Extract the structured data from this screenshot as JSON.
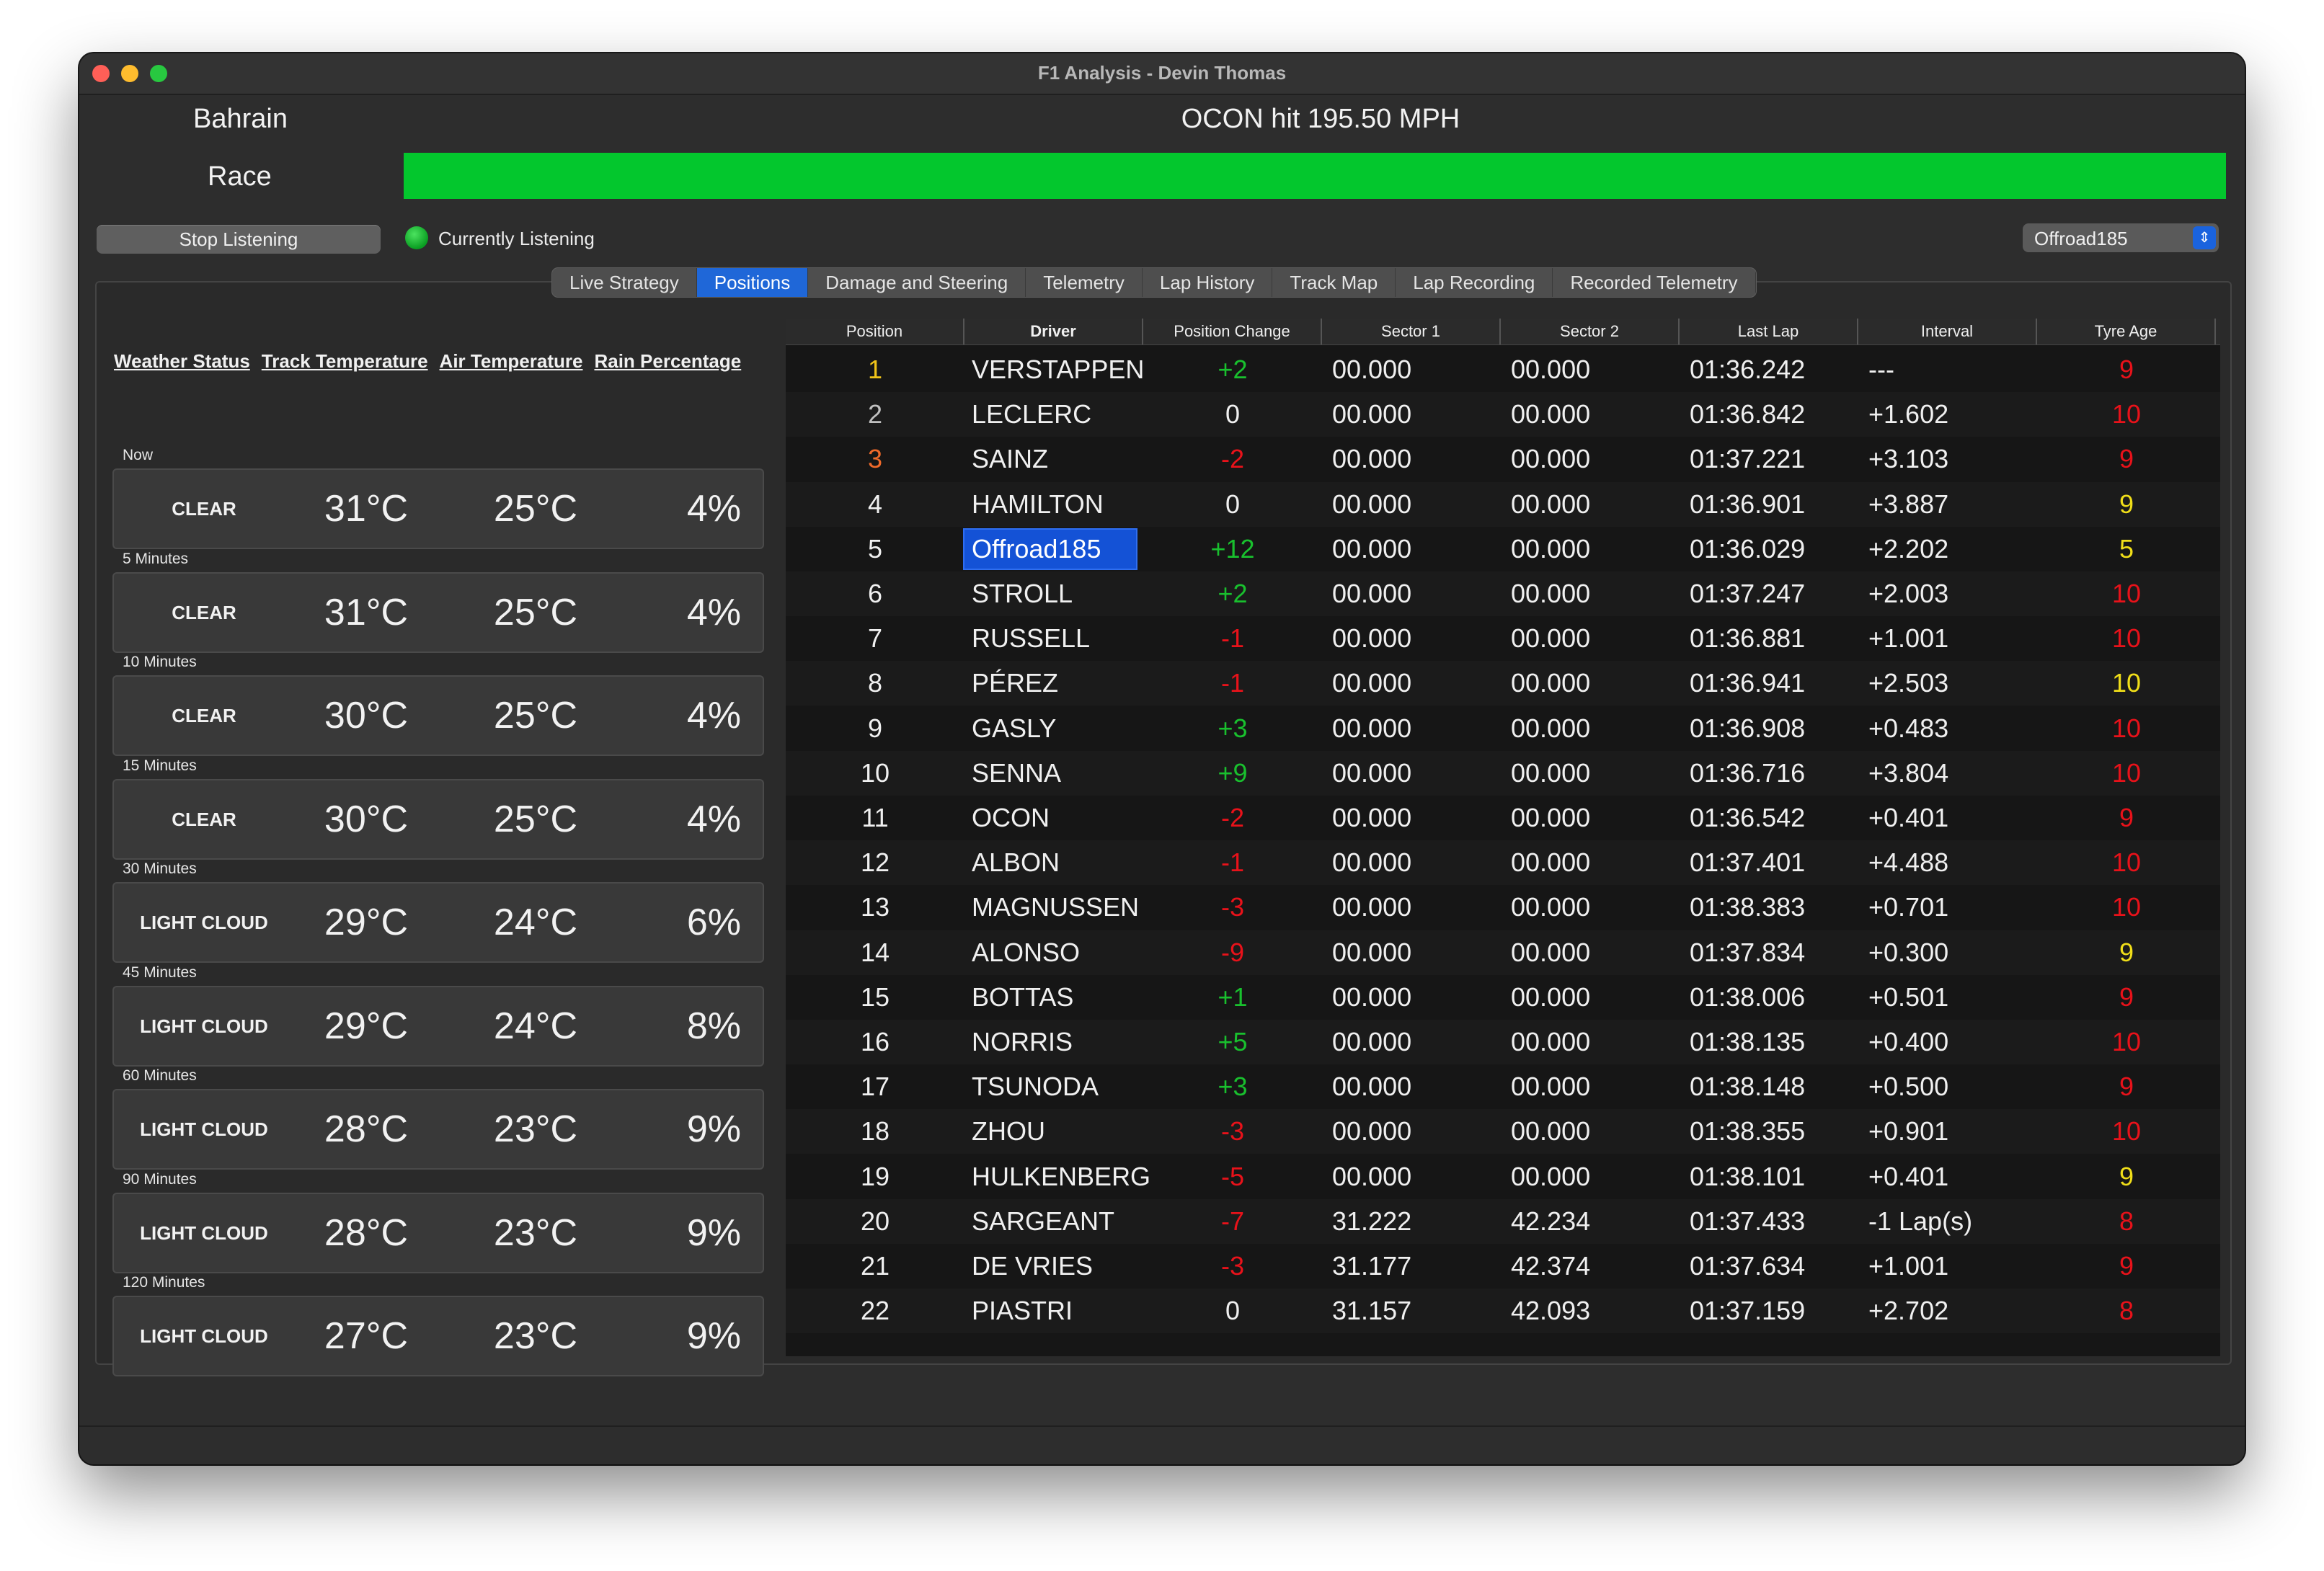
{
  "window": {
    "title": "F1 Analysis - Devin Thomas"
  },
  "header": {
    "track": "Bahrain",
    "session": "Race",
    "headline": "OCON hit 195.50 MPH",
    "progress": 1.0,
    "progress_color": "#03c72d"
  },
  "controls": {
    "stop_label": "Stop Listening",
    "status_label": "Currently Listening",
    "status_color": "#1fbf3a",
    "driver_select": "Offroad185"
  },
  "tabs": [
    {
      "label": "Live Strategy",
      "active": false
    },
    {
      "label": "Positions",
      "active": true
    },
    {
      "label": "Damage and Steering",
      "active": false
    },
    {
      "label": "Telemetry",
      "active": false
    },
    {
      "label": "Lap History",
      "active": false
    },
    {
      "label": "Track Map",
      "active": false
    },
    {
      "label": "Lap Recording",
      "active": false
    },
    {
      "label": "Recorded Telemetry",
      "active": false
    }
  ],
  "weather": {
    "headers": [
      "Weather Status",
      "Track Temperature",
      "Air Temperature",
      "Rain Percentage"
    ],
    "forecasts": [
      {
        "label": "Now",
        "condition": "CLEAR",
        "track": "31°C",
        "air": "25°C",
        "rain": "4%"
      },
      {
        "label": "5 Minutes",
        "condition": "CLEAR",
        "track": "31°C",
        "air": "25°C",
        "rain": "4%"
      },
      {
        "label": "10 Minutes",
        "condition": "CLEAR",
        "track": "30°C",
        "air": "25°C",
        "rain": "4%"
      },
      {
        "label": "15 Minutes",
        "condition": "CLEAR",
        "track": "30°C",
        "air": "25°C",
        "rain": "4%"
      },
      {
        "label": "30 Minutes",
        "condition": "LIGHT CLOUD",
        "track": "29°C",
        "air": "24°C",
        "rain": "6%"
      },
      {
        "label": "45 Minutes",
        "condition": "LIGHT CLOUD",
        "track": "29°C",
        "air": "24°C",
        "rain": "8%"
      },
      {
        "label": "60 Minutes",
        "condition": "LIGHT CLOUD",
        "track": "28°C",
        "air": "23°C",
        "rain": "9%"
      },
      {
        "label": "90 Minutes",
        "condition": "LIGHT CLOUD",
        "track": "28°C",
        "air": "23°C",
        "rain": "9%"
      },
      {
        "label": "120 Minutes",
        "condition": "LIGHT CLOUD",
        "track": "27°C",
        "air": "23°C",
        "rain": "9%"
      }
    ]
  },
  "positions": {
    "columns": [
      "Position",
      "Driver",
      "Position Change",
      "Sector 1",
      "Sector 2",
      "Last Lap",
      "Interval",
      "Tyre Age"
    ],
    "colors": {
      "gold": "#f0c419",
      "silver": "#c0c0c0",
      "bronze": "#f06a2a",
      "gain": "#19c02e",
      "loss": "#e8121a",
      "neutral": "#f0f0f0",
      "tyre_red": "#e8121a",
      "tyre_yellow": "#f0de19"
    },
    "rows": [
      {
        "pos": "1",
        "driver": "VERSTAPPEN",
        "change": "+2",
        "s1": "00.000",
        "s2": "00.000",
        "last": "01:36.242",
        "interval": "---",
        "tyre": "9",
        "pos_color": "gold",
        "change_color": "gain",
        "tyre_color": "tyre_red"
      },
      {
        "pos": "2",
        "driver": "LECLERC",
        "change": "0",
        "s1": "00.000",
        "s2": "00.000",
        "last": "01:36.842",
        "interval": "+1.602",
        "tyre": "10",
        "pos_color": "silver",
        "change_color": "neutral",
        "tyre_color": "tyre_red"
      },
      {
        "pos": "3",
        "driver": "SAINZ",
        "change": "-2",
        "s1": "00.000",
        "s2": "00.000",
        "last": "01:37.221",
        "interval": "+3.103",
        "tyre": "9",
        "pos_color": "bronze",
        "change_color": "loss",
        "tyre_color": "tyre_red"
      },
      {
        "pos": "4",
        "driver": "HAMILTON",
        "change": "0",
        "s1": "00.000",
        "s2": "00.000",
        "last": "01:36.901",
        "interval": "+3.887",
        "tyre": "9",
        "pos_color": "neutral",
        "change_color": "neutral",
        "tyre_color": "tyre_yellow"
      },
      {
        "pos": "5",
        "driver": "Offroad185",
        "change": "+12",
        "s1": "00.000",
        "s2": "00.000",
        "last": "01:36.029",
        "interval": "+2.202",
        "tyre": "5",
        "pos_color": "neutral",
        "change_color": "gain",
        "tyre_color": "tyre_yellow",
        "highlight": true
      },
      {
        "pos": "6",
        "driver": "STROLL",
        "change": "+2",
        "s1": "00.000",
        "s2": "00.000",
        "last": "01:37.247",
        "interval": "+2.003",
        "tyre": "10",
        "pos_color": "neutral",
        "change_color": "gain",
        "tyre_color": "tyre_red"
      },
      {
        "pos": "7",
        "driver": "RUSSELL",
        "change": "-1",
        "s1": "00.000",
        "s2": "00.000",
        "last": "01:36.881",
        "interval": "+1.001",
        "tyre": "10",
        "pos_color": "neutral",
        "change_color": "loss",
        "tyre_color": "tyre_red"
      },
      {
        "pos": "8",
        "driver": "PÉREZ",
        "change": "-1",
        "s1": "00.000",
        "s2": "00.000",
        "last": "01:36.941",
        "interval": "+2.503",
        "tyre": "10",
        "pos_color": "neutral",
        "change_color": "loss",
        "tyre_color": "tyre_yellow"
      },
      {
        "pos": "9",
        "driver": "GASLY",
        "change": "+3",
        "s1": "00.000",
        "s2": "00.000",
        "last": "01:36.908",
        "interval": "+0.483",
        "tyre": "10",
        "pos_color": "neutral",
        "change_color": "gain",
        "tyre_color": "tyre_red"
      },
      {
        "pos": "10",
        "driver": "SENNA",
        "change": "+9",
        "s1": "00.000",
        "s2": "00.000",
        "last": "01:36.716",
        "interval": "+3.804",
        "tyre": "10",
        "pos_color": "neutral",
        "change_color": "gain",
        "tyre_color": "tyre_red"
      },
      {
        "pos": "11",
        "driver": "OCON",
        "change": "-2",
        "s1": "00.000",
        "s2": "00.000",
        "last": "01:36.542",
        "interval": "+0.401",
        "tyre": "9",
        "pos_color": "neutral",
        "change_color": "loss",
        "tyre_color": "tyre_red"
      },
      {
        "pos": "12",
        "driver": "ALBON",
        "change": "-1",
        "s1": "00.000",
        "s2": "00.000",
        "last": "01:37.401",
        "interval": "+4.488",
        "tyre": "10",
        "pos_color": "neutral",
        "change_color": "loss",
        "tyre_color": "tyre_red"
      },
      {
        "pos": "13",
        "driver": "MAGNUSSEN",
        "change": "-3",
        "s1": "00.000",
        "s2": "00.000",
        "last": "01:38.383",
        "interval": "+0.701",
        "tyre": "10",
        "pos_color": "neutral",
        "change_color": "loss",
        "tyre_color": "tyre_red"
      },
      {
        "pos": "14",
        "driver": "ALONSO",
        "change": "-9",
        "s1": "00.000",
        "s2": "00.000",
        "last": "01:37.834",
        "interval": "+0.300",
        "tyre": "9",
        "pos_color": "neutral",
        "change_color": "loss",
        "tyre_color": "tyre_yellow"
      },
      {
        "pos": "15",
        "driver": "BOTTAS",
        "change": "+1",
        "s1": "00.000",
        "s2": "00.000",
        "last": "01:38.006",
        "interval": "+0.501",
        "tyre": "9",
        "pos_color": "neutral",
        "change_color": "gain",
        "tyre_color": "tyre_red"
      },
      {
        "pos": "16",
        "driver": "NORRIS",
        "change": "+5",
        "s1": "00.000",
        "s2": "00.000",
        "last": "01:38.135",
        "interval": "+0.400",
        "tyre": "10",
        "pos_color": "neutral",
        "change_color": "gain",
        "tyre_color": "tyre_red"
      },
      {
        "pos": "17",
        "driver": "TSUNODA",
        "change": "+3",
        "s1": "00.000",
        "s2": "00.000",
        "last": "01:38.148",
        "interval": "+0.500",
        "tyre": "9",
        "pos_color": "neutral",
        "change_color": "gain",
        "tyre_color": "tyre_red"
      },
      {
        "pos": "18",
        "driver": "ZHOU",
        "change": "-3",
        "s1": "00.000",
        "s2": "00.000",
        "last": "01:38.355",
        "interval": "+0.901",
        "tyre": "10",
        "pos_color": "neutral",
        "change_color": "loss",
        "tyre_color": "tyre_red"
      },
      {
        "pos": "19",
        "driver": "HULKENBERG",
        "change": "-5",
        "s1": "00.000",
        "s2": "00.000",
        "last": "01:38.101",
        "interval": "+0.401",
        "tyre": "9",
        "pos_color": "neutral",
        "change_color": "loss",
        "tyre_color": "tyre_yellow"
      },
      {
        "pos": "20",
        "driver": "SARGEANT",
        "change": "-7",
        "s1": "31.222",
        "s2": "42.234",
        "last": "01:37.433",
        "interval": "-1 Lap(s)",
        "tyre": "8",
        "pos_color": "neutral",
        "change_color": "loss",
        "tyre_color": "tyre_red"
      },
      {
        "pos": "21",
        "driver": "DE VRIES",
        "change": "-3",
        "s1": "31.177",
        "s2": "42.374",
        "last": "01:37.634",
        "interval": "+1.001",
        "tyre": "9",
        "pos_color": "neutral",
        "change_color": "loss",
        "tyre_color": "tyre_red"
      },
      {
        "pos": "22",
        "driver": "PIASTRI",
        "change": "0",
        "s1": "31.157",
        "s2": "42.093",
        "last": "01:37.159",
        "interval": "+2.702",
        "tyre": "8",
        "pos_color": "neutral",
        "change_color": "neutral",
        "tyre_color": "tyre_red"
      }
    ]
  }
}
